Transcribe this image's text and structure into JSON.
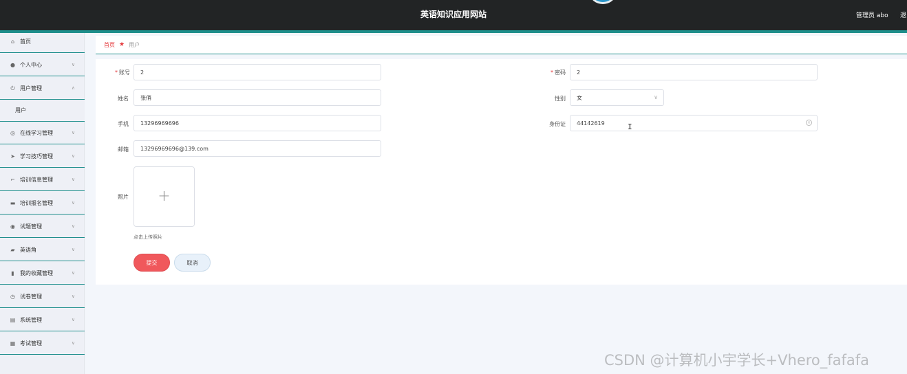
{
  "header": {
    "site_title": "英语知识应用网站",
    "admin_label": "管理员 abo",
    "logout_label": "退"
  },
  "sidebar": {
    "items": [
      {
        "label": "首页",
        "icon": "home-icon"
      },
      {
        "label": "个人中心",
        "icon": "user-icon"
      },
      {
        "label": "用户管理",
        "icon": "power-icon"
      },
      {
        "label": "在线学习管理",
        "icon": "compass-icon"
      },
      {
        "label": "学习技巧管理",
        "icon": "send-icon"
      },
      {
        "label": "培训信息管理",
        "icon": "crop-icon"
      },
      {
        "label": "培训报名管理",
        "icon": "comment-icon"
      },
      {
        "label": "试题管理",
        "icon": "globe-icon"
      },
      {
        "label": "英语角",
        "icon": "briefcase-icon"
      },
      {
        "label": "我的收藏管理",
        "icon": "bookmark-icon"
      },
      {
        "label": "试卷管理",
        "icon": "clock-icon"
      },
      {
        "label": "系统管理",
        "icon": "doc-icon"
      },
      {
        "label": "考试管理",
        "icon": "clipboard-icon"
      }
    ],
    "sub_item": "用户"
  },
  "breadcrumb": {
    "home": "首页",
    "current": "用户"
  },
  "form": {
    "account_label": "账号",
    "account_value": "2",
    "password_label": "密码",
    "password_value": "2",
    "name_label": "姓名",
    "name_value": "张俏",
    "gender_label": "性别",
    "gender_value": "女",
    "phone_label": "手机",
    "phone_value": "13296969696",
    "idcard_label": "身份证",
    "idcard_value": "44142619",
    "email_label": "邮箱",
    "email_value": "13296969696@139.com",
    "photo_label": "照片",
    "upload_hint": "点击上传照片",
    "submit_label": "提交",
    "cancel_label": "取消"
  },
  "watermark": "CSDN @计算机小宇学长+Vhero_fafafa",
  "colors": {
    "header_bg": "#222425",
    "accent_teal": "#1f8f8c",
    "submit_red": "#f0585c",
    "crumb_red": "#e4393c"
  }
}
